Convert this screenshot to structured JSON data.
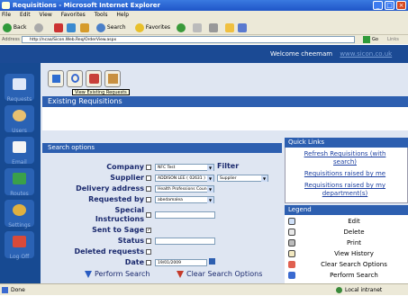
{
  "window": {
    "title": "Requisitions - Microsoft Internet Explorer"
  },
  "menu": [
    "File",
    "Edit",
    "View",
    "Favorites",
    "Tools",
    "Help"
  ],
  "toolbar": {
    "back": "Back",
    "search": "Search",
    "favorites": "Favorites"
  },
  "address": {
    "label": "Address",
    "url": "http://ncaa/Sicon.Web.Req/OrderView.aspx",
    "go": "Go",
    "links": "Links"
  },
  "header": {
    "welcome": "Welcome cheemam",
    "site": "www.sicon.co.uk"
  },
  "nav": [
    "Requests",
    "Users",
    "Email",
    "Routes",
    "Settings",
    "Log Off"
  ],
  "tooltip": "View Existing Requests",
  "existing_title": "Existing Requisitions",
  "search": {
    "title": "Search options",
    "company_label": "Company",
    "company_value": "NFC Test",
    "supplier_label": "Supplier",
    "supplier_value": "ADDISON LEE ( 02631 )",
    "delivery_label": "Delivery address",
    "delivery_value": "Health Professions Council",
    "requested_label": "Requested by",
    "requested_value": "abedamalea",
    "special_label": "Special",
    "special_label2": "Instructions",
    "sage_label": "Sent to Sage",
    "status_label": "Status",
    "deleted_label": "Deleted requests",
    "date_label": "Date",
    "date_value": "19/01/2009",
    "filter_label": "Filter",
    "filter_value": "Supplier",
    "perform": "Perform Search",
    "clear": "Clear Search Options"
  },
  "quick": {
    "title": "Quick Links",
    "links": [
      "Refresh Requisitions (with",
      "search)",
      "Requisitions raised by me",
      "Requisitions raised by my",
      "department(s)"
    ]
  },
  "legend": {
    "title": "Legend",
    "items": [
      "Edit",
      "Delete",
      "Print",
      "View History",
      "Clear Search Options",
      "Perform Search"
    ]
  },
  "status": {
    "left": "Done",
    "right": "Local intranet"
  }
}
